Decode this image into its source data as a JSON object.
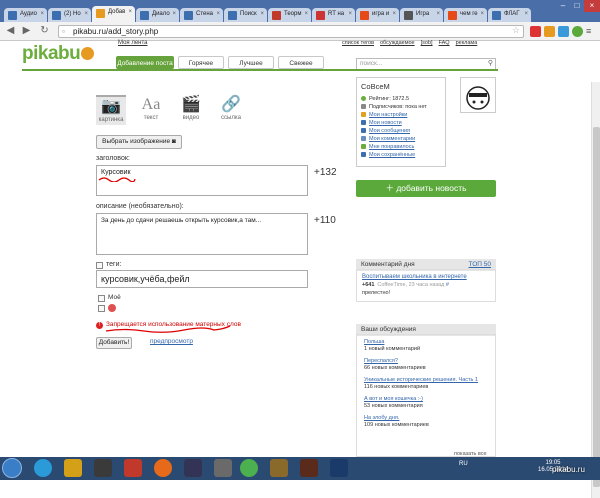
{
  "browser": {
    "tabs": [
      {
        "label": "Аудио",
        "color": "#3d6fb0",
        "active": false
      },
      {
        "label": "(2) Но",
        "color": "#3d6fb0",
        "active": false
      },
      {
        "label": "Добав",
        "color": "#e69a20",
        "active": true
      },
      {
        "label": "Диало",
        "color": "#3d6fb0",
        "active": false
      },
      {
        "label": "Стена",
        "color": "#3d6fb0",
        "active": false
      },
      {
        "label": "Поиск",
        "color": "#3d6fb0",
        "active": false
      },
      {
        "label": "Теорм",
        "color": "#c0392b",
        "active": false
      },
      {
        "label": "RT на",
        "color": "#cc3333",
        "active": false
      },
      {
        "label": "игра и",
        "color": "#e64a19",
        "active": false
      },
      {
        "label": "Игра ",
        "color": "#555555",
        "active": false
      },
      {
        "label": "чем ге",
        "color": "#e64a19",
        "active": false
      },
      {
        "label": "ФЛАГ",
        "color": "#3d6fb0",
        "active": false
      }
    ],
    "url": "pikabu.ru/add_story.php"
  },
  "site": {
    "logo": "pikabu",
    "my_feed": "Моя лента",
    "top_links": [
      "список тегов",
      "обсуждаемое",
      "[sob]",
      "FAQ",
      "реклама"
    ],
    "nav": [
      "Добавление поста",
      "Горячее",
      "Лучшее",
      "Свежее"
    ],
    "search_placeholder": "поиск..."
  },
  "form": {
    "types": [
      {
        "label": "картинка",
        "icon": "camera-icon"
      },
      {
        "label": "текст",
        "icon": "text-icon"
      },
      {
        "label": "видео",
        "icon": "video-icon"
      },
      {
        "label": "ссылка",
        "icon": "link-icon"
      }
    ],
    "choose_image": "Выбрать изображение",
    "title_label": "заголовок:",
    "title_value": "Курсовик",
    "title_counter": "+132",
    "desc_label": "описание (необязательно):",
    "desc_value": "За день до сдачи решаешь открыть курсовик,а там...",
    "desc_counter": "+110",
    "tags_label": "теги:",
    "tags_value": "курсовик,учёба,фейл",
    "mine_label": "Моё",
    "warning": "Запрещается использование матерных слов",
    "submit": "Добавить!",
    "preview": "предпросмотр"
  },
  "user": {
    "name": "СоВсеМ",
    "rating": "Рейтинг: 1872.5",
    "subscribers": "Подписчиков: пока нет",
    "links": [
      {
        "label": "Мои настройки",
        "color": "#e0a020"
      },
      {
        "label": "Мои новости",
        "color": "#3d6fb0"
      },
      {
        "label": "Мои сообщения",
        "color": "#3d6fb0"
      },
      {
        "label": "Мои комментарии",
        "color": "#6a8fbf"
      },
      {
        "label": "Мне понравилось",
        "color": "#6cae3e"
      },
      {
        "label": "Мои сохранённые",
        "color": "#3d6fb0"
      }
    ]
  },
  "sidebar": {
    "add_news": "добавить новость",
    "comment_of_day": "Комментарий дня",
    "top50": "ТОП 50",
    "cod_title": "Воспитываем школьника в интернете",
    "cod_score": "+641",
    "cod_author": "CoffeeTime, 23 часа назад",
    "cod_hash": "#",
    "cod_text": "прелестно!",
    "discussions_title": "Ваши обсуждения",
    "discussions": [
      {
        "title": "Польша",
        "count": "1 новый комментарий"
      },
      {
        "title": "Переспался?",
        "count": "66 новых комментариев"
      },
      {
        "title": "Уникальные исторические решения. Часть 1",
        "count": "116 новых комментариев"
      },
      {
        "title": "А вот и моя кошечка :-)",
        "count": "53 новых комментария"
      },
      {
        "title": "На злобу дня.",
        "count": "109 новых комментариев"
      }
    ],
    "show_all": "показать все"
  },
  "taskbar": {
    "lang": "RU",
    "time": "19:05",
    "date": "16.05.2014",
    "watermark": "pikabu.ru"
  }
}
